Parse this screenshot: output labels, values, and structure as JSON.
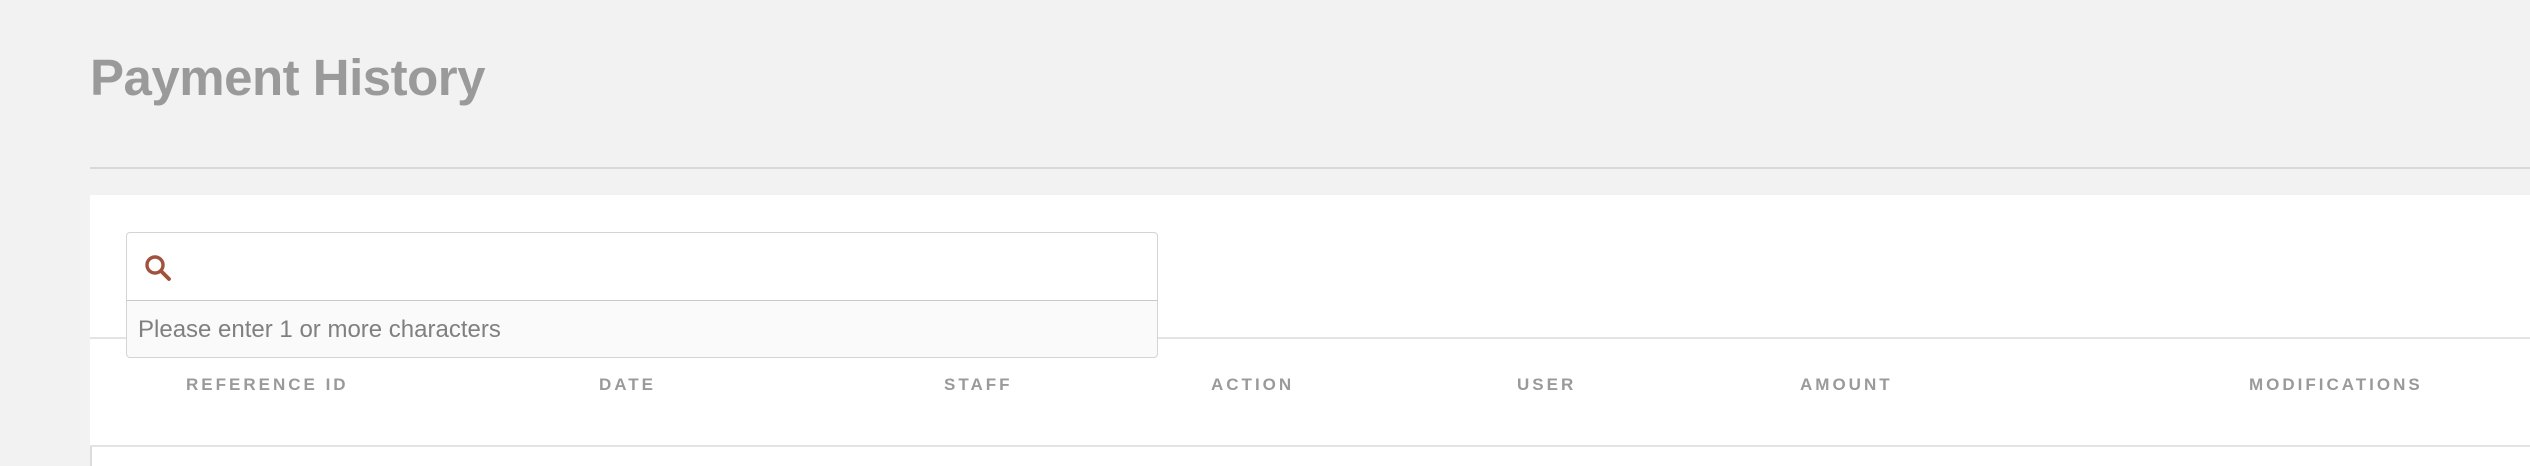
{
  "page": {
    "title": "Payment History"
  },
  "search": {
    "value": "",
    "placeholder": "",
    "hint": "Please enter 1 or more characters",
    "icon": "search-icon",
    "icon_color": "#a0523d"
  },
  "table": {
    "columns": [
      "REFERENCE ID",
      "DATE",
      "STAFF",
      "ACTION",
      "USER",
      "AMOUNT",
      "MODIFICATIONS"
    ]
  },
  "colors": {
    "background": "#f2f2f2",
    "panel": "#ffffff",
    "title_text": "#9a9a9a",
    "header_text": "#9a9a9a",
    "accent": "#a0523d"
  }
}
